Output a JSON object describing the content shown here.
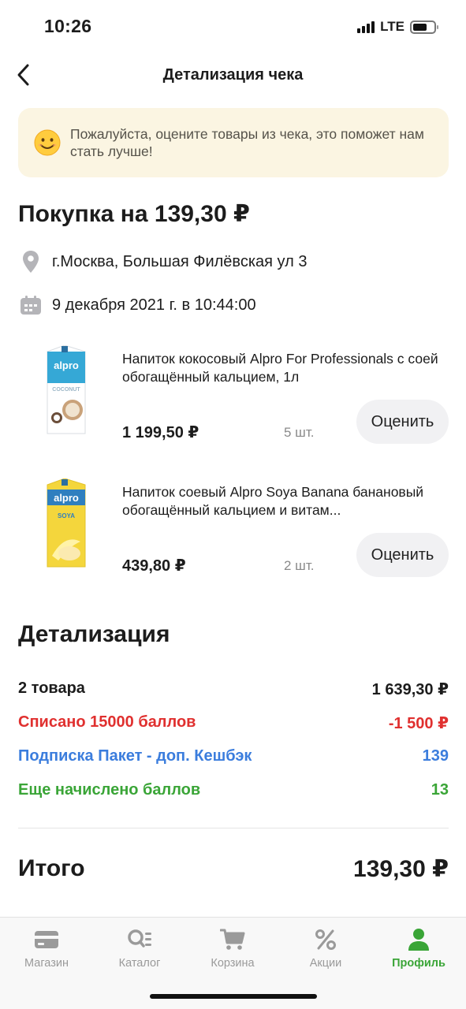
{
  "status_bar": {
    "time": "10:26",
    "network": "LTE",
    "battery_level": 0.68
  },
  "header": {
    "title": "Детализация чека",
    "back_icon": "chevron-left-icon"
  },
  "banner": {
    "text": "Пожалуйста, оцените товары из чека, это поможет нам стать лучше!",
    "icon": "smiley-icon"
  },
  "purchase": {
    "title": "Покупка на 139,30 ₽",
    "address": "г.Москва, Большая Филёвская ул 3",
    "datetime": "9 декабря 2021 г. в 10:44:00"
  },
  "products": [
    {
      "name": "Напиток кокосовый Alpro For Professionals с соей обогащённый кальцием, 1л",
      "price": "1 199,50 ₽",
      "quantity": "5 шт.",
      "rate_label": "Оценить",
      "pack_color": "#35a8d6",
      "pack_brand": "alpro",
      "pack_flavor": "COCONUT"
    },
    {
      "name": "Напиток соевый Alpro Soya Banana банановый обогащённый кальцием и витам...",
      "price": "439,80 ₽",
      "quantity": "2 шт.",
      "rate_label": "Оценить",
      "pack_color": "#f4d63c",
      "pack_brand": "alpro",
      "pack_flavor": "SOYA"
    }
  ],
  "details": {
    "title": "Детализация",
    "rows": [
      {
        "label": "2 товара",
        "value": "1 639,30 ₽",
        "color": "#1c1c1c"
      },
      {
        "label": "Списано 15000 баллов",
        "value": "-1 500 ₽",
        "color": "#e0302f"
      },
      {
        "label": "Подписка Пакет - доп. Кешбэк",
        "value": "139",
        "color": "#3b7ddd"
      },
      {
        "label": "Еще начислено баллов",
        "value": "13",
        "color": "#3aa537"
      }
    ],
    "total_label": "Итого",
    "total_value": "139,30 ₽"
  },
  "tabbar": {
    "items": [
      {
        "label": "Магазин",
        "icon": "card-icon",
        "active": false
      },
      {
        "label": "Каталог",
        "icon": "catalog-search-icon",
        "active": false
      },
      {
        "label": "Корзина",
        "icon": "cart-icon",
        "active": false
      },
      {
        "label": "Акции",
        "icon": "percent-icon",
        "active": false
      },
      {
        "label": "Профиль",
        "icon": "profile-icon",
        "active": true
      }
    ]
  },
  "colors": {
    "accent_green": "#3aa537",
    "banner_bg": "#fbf5e2",
    "tab_inactive": "#9a9a9a"
  }
}
